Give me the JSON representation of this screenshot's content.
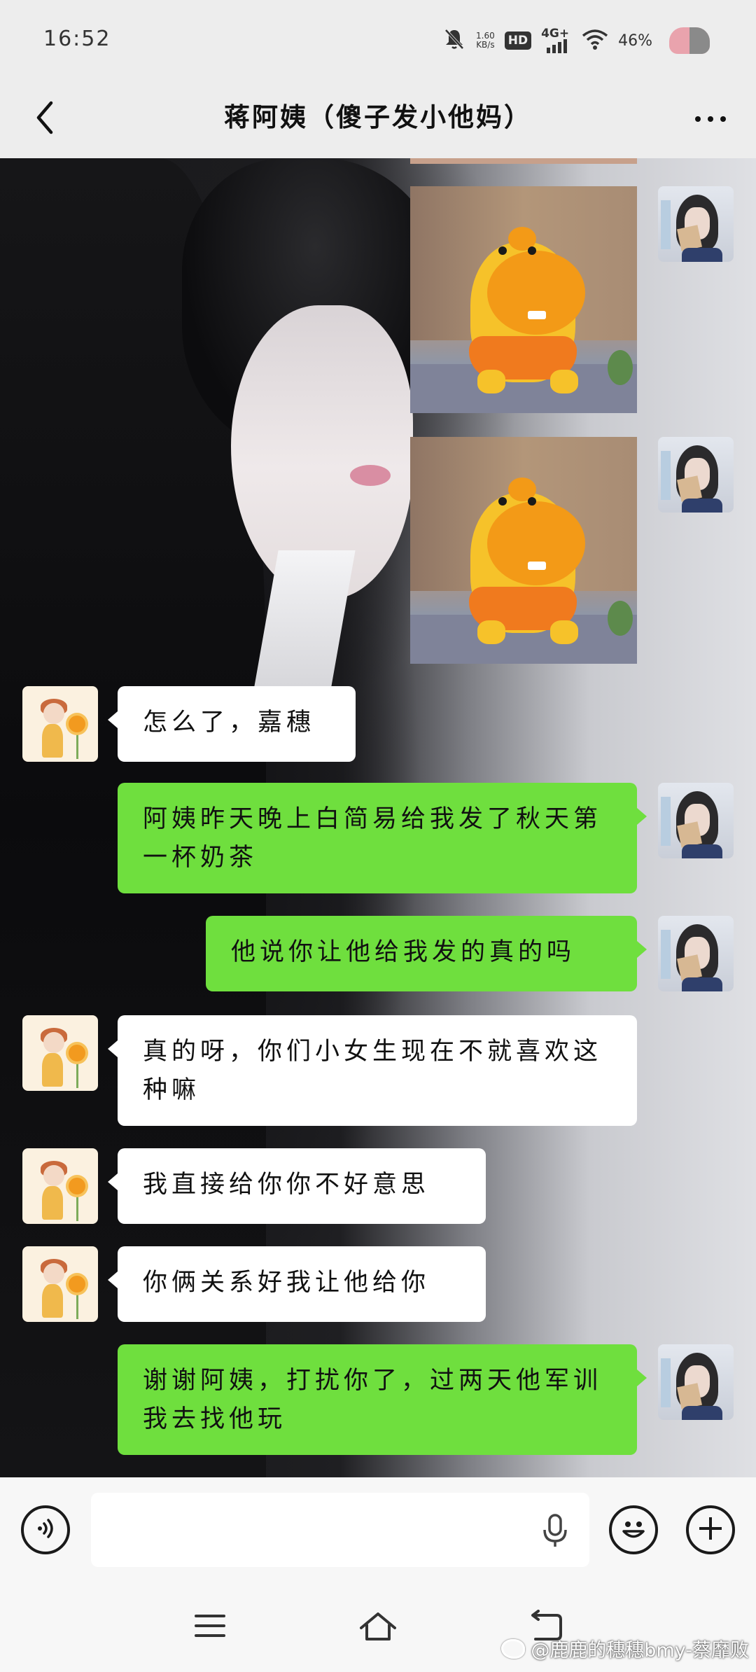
{
  "status_bar": {
    "time": "16:52",
    "net_speed_value": "1.60",
    "net_speed_unit": "KB/s",
    "hd_label": "HD",
    "network_label": "4G+",
    "battery_percent": "46%"
  },
  "header": {
    "title": "蒋阿姨（傻子发小他妈）"
  },
  "messages": [
    {
      "sender": "me",
      "type": "sticker"
    },
    {
      "sender": "me",
      "type": "sticker"
    },
    {
      "sender": "aunt",
      "type": "text",
      "text": "怎么了，嘉穗"
    },
    {
      "sender": "me",
      "type": "text",
      "text": "阿姨昨天晚上白简易给我发了秋天第一杯奶茶"
    },
    {
      "sender": "me",
      "type": "text",
      "text": "他说你让他给我发的真的吗"
    },
    {
      "sender": "aunt",
      "type": "text",
      "text": "真的呀，你们小女生现在不就喜欢这种嘛"
    },
    {
      "sender": "aunt",
      "type": "text",
      "text": "我直接给你你不好意思"
    },
    {
      "sender": "aunt",
      "type": "text",
      "text": "你俩关系好我让他给你"
    },
    {
      "sender": "me",
      "type": "text",
      "text": "谢谢阿姨，打扰你了，过两天他军训我去找他玩"
    }
  ],
  "input_bar": {
    "placeholder": ""
  },
  "watermark": {
    "text": "@鹿鹿的穗穗bmy-蔡靡败"
  },
  "colors": {
    "my_bubble": "#6fdf3e",
    "their_bubble": "#ffffff",
    "bar_background": "#ededed"
  },
  "icons": {
    "back": "chevron-left-icon",
    "more": "more-dots-icon",
    "voice": "voice-icon",
    "mic": "mic-icon",
    "emoji": "emoji-icon",
    "plus": "plus-icon",
    "nav_menu": "menu-icon",
    "nav_home": "home-icon",
    "nav_back": "back-arrow-icon"
  }
}
